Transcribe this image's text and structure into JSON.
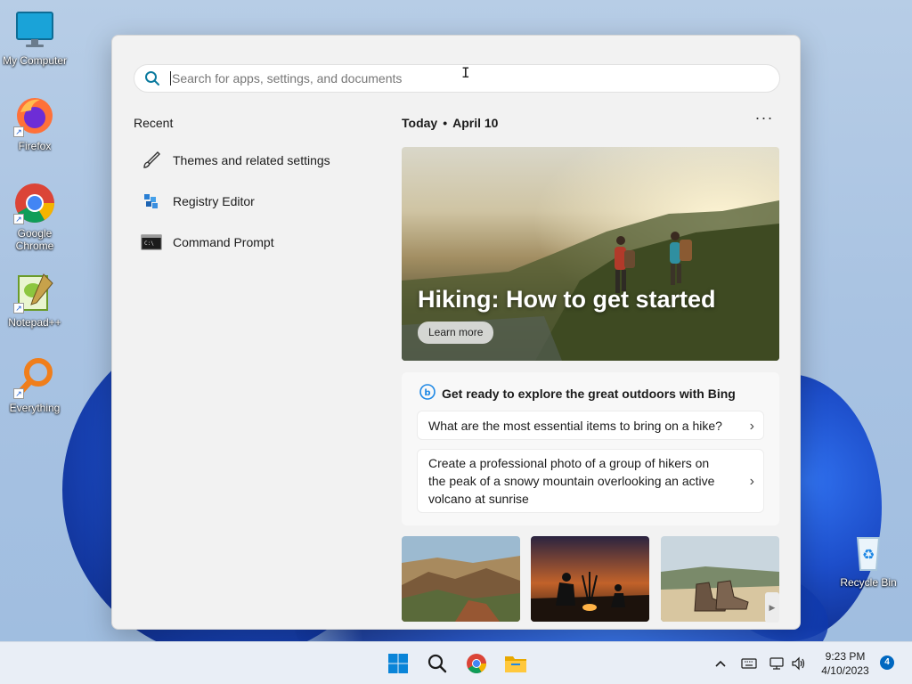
{
  "desktop": {
    "icons": [
      {
        "label": "My Computer",
        "icon": "monitor-icon"
      },
      {
        "label": "Firefox",
        "icon": "firefox-icon"
      },
      {
        "label": "Google Chrome",
        "icon": "chrome-icon"
      },
      {
        "label": "Notepad++",
        "icon": "notepadpp-icon"
      },
      {
        "label": "Everything",
        "icon": "everything-search-icon"
      },
      {
        "label": "Recycle Bin",
        "icon": "recycle-bin-icon"
      }
    ]
  },
  "start_menu": {
    "search": {
      "placeholder": "Search for apps, settings, and documents",
      "value": ""
    },
    "recent": {
      "title": "Recent",
      "items": [
        {
          "label": "Themes and related settings",
          "icon": "brush-icon"
        },
        {
          "label": "Registry Editor",
          "icon": "registry-editor-icon"
        },
        {
          "label": "Command Prompt",
          "icon": "command-prompt-icon"
        }
      ]
    },
    "feed": {
      "today_label": "Today",
      "separator": "•",
      "date": "April 10",
      "more_label": "···",
      "hero": {
        "title": "Hiking: How to get started",
        "button": "Learn more"
      },
      "bing_card": {
        "heading": "Get ready to explore the great outdoors with Bing",
        "questions": [
          "What are the most essential items to bring on a hike?",
          "Create a professional photo of a group of hikers on the peak of a snowy mountain overlooking an active volcano at sunrise"
        ]
      },
      "thumbnails": [
        {
          "icon": "mountain-valley-image"
        },
        {
          "icon": "campfire-image"
        },
        {
          "icon": "hiking-boots-image"
        }
      ]
    }
  },
  "taskbar": {
    "apps": [
      {
        "icon": "windows-start-icon"
      },
      {
        "icon": "search-icon"
      },
      {
        "icon": "chrome-icon"
      },
      {
        "icon": "file-explorer-icon"
      }
    ],
    "tray": {
      "icons": [
        "chevron-up-icon",
        "keyboard-icon",
        "network-icon",
        "volume-icon"
      ],
      "time": "9:23 PM",
      "date": "4/10/2023",
      "notification_count": "4"
    }
  },
  "colors": {
    "accent": "#0067c0",
    "wallpaper_bloom": "#1648c9"
  }
}
